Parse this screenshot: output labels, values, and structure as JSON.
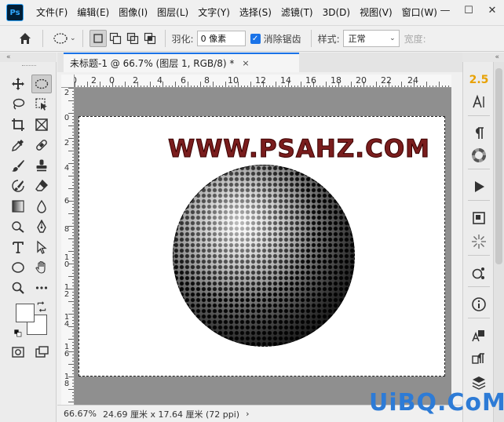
{
  "app": {
    "logo": "Ps"
  },
  "menu": [
    "文件(F)",
    "编辑(E)",
    "图像(I)",
    "图层(L)",
    "文字(Y)",
    "选择(S)",
    "滤镜(T)",
    "3D(D)",
    "视图(V)",
    "窗口(W)"
  ],
  "window_controls": {
    "minimize": "—",
    "restore": "☐",
    "close": "✕"
  },
  "options": {
    "feather_label": "羽化:",
    "feather_value": "0 像素",
    "antialias_label": "消除锯齿",
    "antialias_checked": true,
    "style_label": "样式:",
    "style_value": "正常",
    "width_label": "宽度:"
  },
  "panel_collapse": "«",
  "document": {
    "tab_title": "未标题-1 @ 66.7% (图层 1, RGB/8) *",
    "close": "×",
    "canvas_text": "WWW.PSAHZ.COM"
  },
  "ruler_h": [
    "0",
    "2",
    "0",
    "2",
    "4",
    "6",
    "8",
    "10",
    "12",
    "14",
    "16",
    "18",
    "20",
    "22",
    "24"
  ],
  "ruler_v": [
    "2",
    "0",
    "2",
    "4",
    "6",
    "8",
    "1\n0",
    "1\n2",
    "1\n4",
    "1\n6",
    "1\n8"
  ],
  "status": {
    "zoom": "66.67%",
    "info": "24.69 厘米 x 17.64 厘米 (72 ppi)",
    "arrow": "›"
  },
  "right_panel": {
    "version_badge": "2.5"
  },
  "watermark": "UiBQ.CoM",
  "colors": {
    "accent": "#1a73e8",
    "title_text": "#7a1d1d",
    "pasteboard": "#8f8f8f"
  }
}
